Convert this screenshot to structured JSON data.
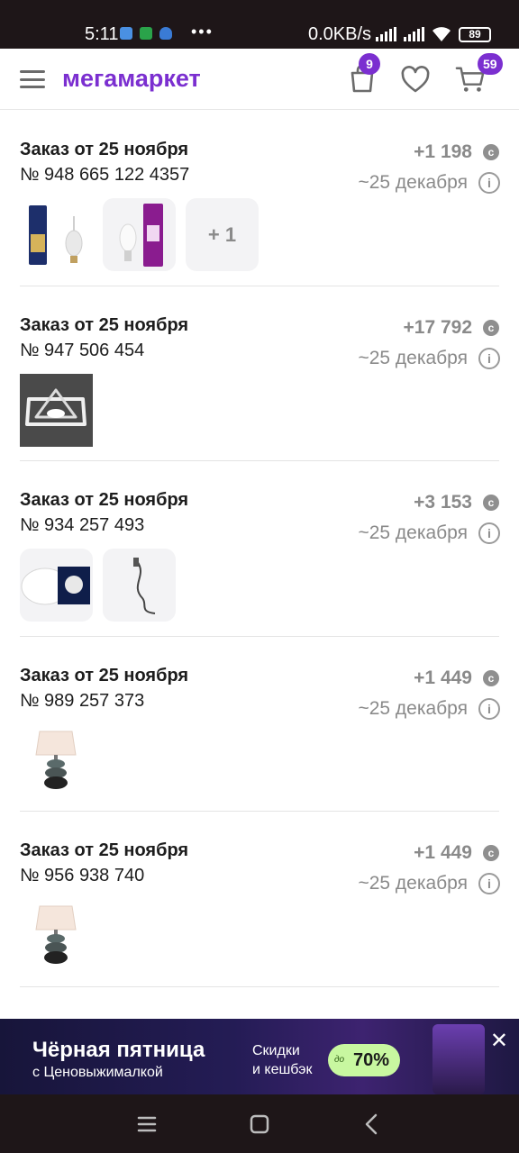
{
  "status_bar": {
    "time": "5:11",
    "dots": "•••",
    "net_speed": "0.0KB/s",
    "battery": "89"
  },
  "header": {
    "logo": "мегамаркет",
    "bag_badge": "9",
    "cart_badge": "59",
    "icons": [
      "menu-icon",
      "shopping-bag-icon",
      "heart-icon",
      "cart-icon"
    ],
    "accent_color": "#7b2fd0"
  },
  "orders": [
    {
      "title": "Заказ от 25 ноября",
      "number": "№ 948 665 122 4357",
      "bonus": "+1 198",
      "delivery": "~25 декабря",
      "extra_items": "+ 1"
    },
    {
      "title": "Заказ от 25 ноября",
      "number": "№ 947 506 454",
      "bonus": "+17 792",
      "delivery": "~25 декабря"
    },
    {
      "title": "Заказ от 25 ноября",
      "number": "№ 934 257 493",
      "bonus": "+3 153",
      "delivery": "~25 декабря"
    },
    {
      "title": "Заказ от 25 ноября",
      "number": "№ 989 257 373",
      "bonus": "+1 449",
      "delivery": "~25 декабря"
    },
    {
      "title": "Заказ от 25 ноября",
      "number": "№ 956 938 740",
      "bonus": "+1 449",
      "delivery": "~25 декабря"
    }
  ],
  "banner": {
    "title": "Чёрная пятница",
    "subtitle": "с Ценовыжималкой",
    "line1": "Скидки",
    "line2": "и кешбэк",
    "pill_prefix": "до",
    "pill_value": "70%"
  }
}
